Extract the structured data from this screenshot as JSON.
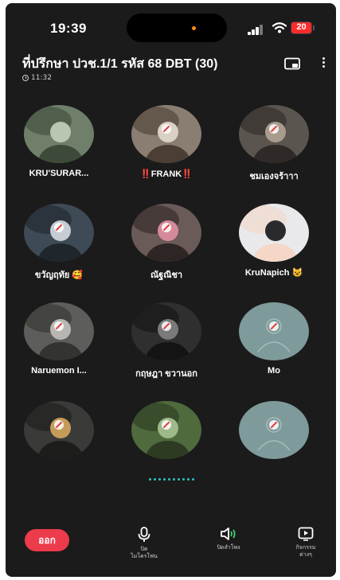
{
  "status": {
    "time": "19:39",
    "battery": "20"
  },
  "meeting": {
    "title": "ที่ปรึกษา ปวช.1/1 รหัส 68 DBT (30)",
    "elapsed": "11:32"
  },
  "participants": [
    {
      "name": "KRU'SURAR...",
      "avatar": "photo"
    },
    {
      "name": "‼️FRANK‼️",
      "avatar": "photo"
    },
    {
      "name": "ชมเองจร้าาา",
      "avatar": "photo"
    },
    {
      "name": "ขวัญฤทัย 🥰",
      "avatar": "photo"
    },
    {
      "name": "ณัฐณิชา",
      "avatar": "photo"
    },
    {
      "name": "KruNapich 😺",
      "avatar": "photo"
    },
    {
      "name": "Naruemon I...",
      "avatar": "photo"
    },
    {
      "name": "กฤษฎา ขวานอก",
      "avatar": "photo"
    },
    {
      "name": "Mo",
      "avatar": "placeholder"
    },
    {
      "name": "",
      "avatar": "photo"
    },
    {
      "name": "",
      "avatar": "photo"
    },
    {
      "name": "",
      "avatar": "placeholder"
    }
  ],
  "controls": {
    "leave": "ออก",
    "mic": "ปิด\nไมโครโฟน",
    "speaker": "ปิดลำโพง",
    "activities": "กิจกรรม\nต่างๆ"
  },
  "colors": {
    "background": "#1b1b1b",
    "leave": "#ec3b4b",
    "accent": "#2fc1c1",
    "speaker_on": "#3ad36a"
  },
  "icons": [
    "clock-icon",
    "picture-in-picture-icon",
    "more-vertical-icon",
    "microphone-icon",
    "speaker-icon",
    "activities-icon",
    "muted-icon"
  ]
}
